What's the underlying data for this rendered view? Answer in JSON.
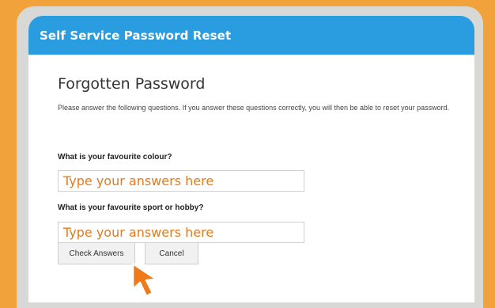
{
  "window": {
    "title": "Self Service Password Reset"
  },
  "form": {
    "heading": "Forgotten Password",
    "intro": "Please answer the following questions. If you answer these questions correctly, you will then be able to reset your password.",
    "questions": [
      {
        "label": "What is your favourite colour?",
        "placeholder": "Type your answers here"
      },
      {
        "label": "What is your favourite sport or hobby?",
        "placeholder": "Type your answers here"
      }
    ],
    "check_label": "Check Answers",
    "cancel_label": "Cancel"
  },
  "colors": {
    "background": "#f2a23a",
    "titlebar": "#2a9ce0",
    "placeholder_text": "#e07b20",
    "cursor": "#f07a1a"
  },
  "icons": {
    "pointer": "arrow-pointer-icon"
  }
}
